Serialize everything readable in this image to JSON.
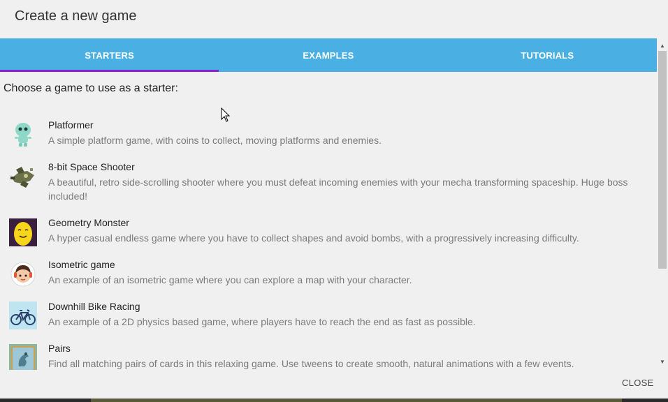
{
  "dialog": {
    "title": "Create a new game",
    "close_label": "CLOSE"
  },
  "tabs": [
    {
      "label": "STARTERS",
      "active": true
    },
    {
      "label": "EXAMPLES",
      "active": false
    },
    {
      "label": "TUTORIALS",
      "active": false
    }
  ],
  "intro": "Choose a game to use as a starter:",
  "games": [
    {
      "title": "Platformer",
      "description": "A simple platform game, with coins to collect, moving platforms and enemies.",
      "icon": "alien-icon"
    },
    {
      "title": "8-bit Space Shooter",
      "description": "A beautiful, retro side-scrolling shooter where you must defeat incoming enemies with your mecha transforming spaceship. Huge boss included!",
      "icon": "spaceship-icon"
    },
    {
      "title": "Geometry Monster",
      "description": "A hyper casual endless game where you have to collect shapes and avoid bombs, with a progressively increasing difficulty.",
      "icon": "monster-icon"
    },
    {
      "title": "Isometric game",
      "description": "An example of an isometric game where you can explore a map with your character.",
      "icon": "character-icon"
    },
    {
      "title": "Downhill Bike Racing",
      "description": "An example of a 2D physics based game, where players have to reach the end as fast as possible.",
      "icon": "bike-icon"
    },
    {
      "title": "Pairs",
      "description": "Find all matching pairs of cards in this relaxing game. Use tweens to create smooth, natural animations with a few events.",
      "icon": "cards-icon"
    }
  ],
  "colors": {
    "tabbar": "#4ab0e4",
    "active_indicator": "#8a1fd6",
    "dialog_bg": "#f0f0f0"
  }
}
